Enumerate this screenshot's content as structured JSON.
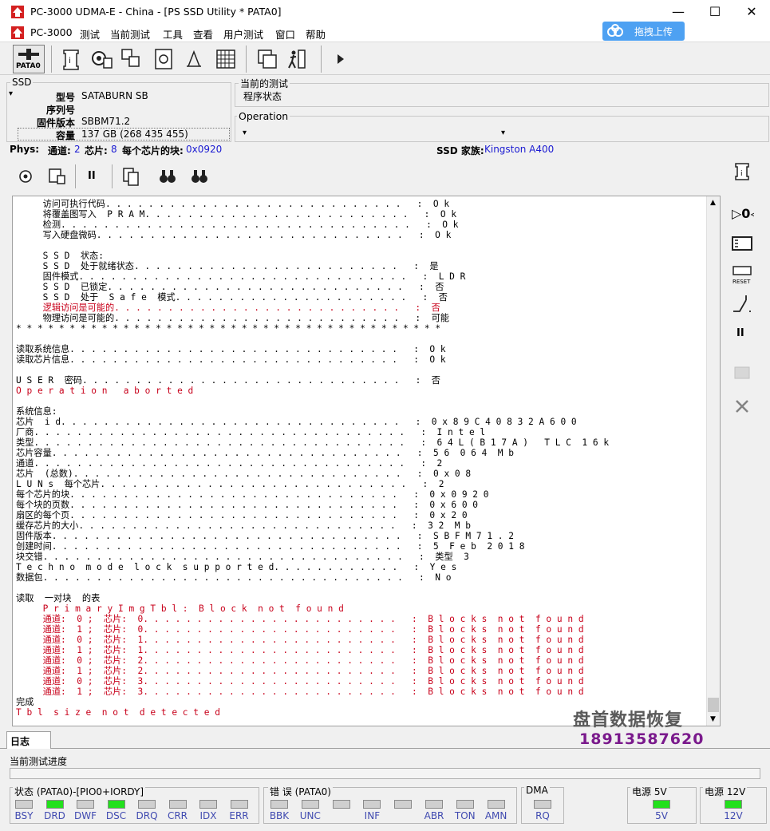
{
  "window": {
    "title": "PC-3000 UDMA-E - China - [PS SSD Utility * PATA0]",
    "minimize": "—",
    "maximize": "☐",
    "close": "✕"
  },
  "menu": {
    "items": [
      "PC-3000",
      "测试",
      "当前测试",
      "工具",
      "查看",
      "用户测试",
      "窗口",
      "帮助"
    ],
    "upload_label": "拖拽上传"
  },
  "toolbar": {
    "pata_label": "PATA0"
  },
  "ssd": {
    "group_label": "SSD",
    "model_label": "型号",
    "model_value": "SATABURN   SB",
    "serial_label": "序列号",
    "serial_value": "",
    "firmware_label": "固件版本",
    "firmware_value": "SBBM71.2",
    "capacity_label": "容量",
    "capacity_value": "137 GB (268 435 455)"
  },
  "current_test": {
    "group_label": "当前的测试",
    "value": "程序状态"
  },
  "operation": {
    "group_label": "Operation",
    "value": ""
  },
  "phys": {
    "label": "Phys:",
    "channel_label": "通道:",
    "channel_value": "2",
    "chips_label": "芯片:",
    "chips_value": "8",
    "blocks_label": "每个芯片的块:",
    "blocks_value": "0x0920",
    "family_label": "SSD 家族:",
    "family_value": "Kingston A400"
  },
  "log_lines": [
    {
      "t": "     访问可执行代码. . . . . . . . . . . . . . . . . . . . . . . . . . . .   :  O k",
      "red": false
    },
    {
      "t": "     将覆盖图写入  P R A M. . . . . . . . . . . . . . . . . . . . . . . . .   :  O k",
      "red": false
    },
    {
      "t": "     检测. . . . . . . . . . . . . . . . . . . . . . . . . . . . . . . . .   :  O k",
      "red": false
    },
    {
      "t": "     写入硬盘微码. . . . . . . . . . . . . . . . . . . . . . . . . . . . .   :  O k",
      "red": false
    },
    {
      "t": "",
      "red": false
    },
    {
      "t": "     S S D  状态:",
      "red": false
    },
    {
      "t": "     S S D  处于就绪状态. . . . . . . . . . . . . . . . . . . . . . . . .   :  是",
      "red": false
    },
    {
      "t": "     固件模式. . . . . . . . . . . . . . . . . . . . . . . . . . . . . . .   :  L D R",
      "red": false
    },
    {
      "t": "     S S D  已锁定. . . . . . . . . . . . . . . . . . . . . . . . . . . .   :  否",
      "red": false
    },
    {
      "t": "     S S D  处于  S a f e  模式. . . . . . . . . . . . . . . . . . . . . .   :  否",
      "red": false
    },
    {
      "t": "     逻辑访问是可能的. . . . . . . . . . . . . . . . . . . . . . . . . . .   :  否",
      "red": true
    },
    {
      "t": "     物理访问是可能的. . . . . . . . . . . . . . . . . . . . . . . . . . .   :  可能",
      "red": false
    },
    {
      "t": "* * * * * * * * * * * * * * * * * * * * * * * * * * * * * * * * * * * * * * * *",
      "red": false
    },
    {
      "t": "",
      "red": false
    },
    {
      "t": "读取系统信息. . . . . . . . . . . . . . . . . . . . . . . . . . . . . . .   :  O k",
      "red": false
    },
    {
      "t": "读取芯片信息. . . . . . . . . . . . . . . . . . . . . . . . . . . . . . .   :  O k",
      "red": false
    },
    {
      "t": "",
      "red": false
    },
    {
      "t": "U S E R  密码. . . . . . . . . . . . . . . . . . . . . . . . . . . . . .   :  否",
      "red": false
    },
    {
      "t": "O p e r a t i o n   a b o r t e d",
      "red": true
    },
    {
      "t": "",
      "red": false
    },
    {
      "t": "系统信息:",
      "red": false
    },
    {
      "t": "芯片  i d. . . . . . . . . . . . . . . . . . . . . . . . . . . . . . . .   :  0 x 8 9 C 4 0 8 3 2 A 6 0 0",
      "red": false
    },
    {
      "t": "厂商. . . . . . . . . . . . . . . . . . . . . . . . . . . . . . . . . . .   :  I n t e l",
      "red": false
    },
    {
      "t": "类型. . . . . . . . . . . . . . . . . . . . . . . . . . . . . . . . . . .   :  6 4 L ( B 1 7 A )   T L C  1 6 k",
      "red": false
    },
    {
      "t": "芯片容量. . . . . . . . . . . . . . . . . . . . . . . . . . . . . . . . .   :  5 6  0 6 4  M b",
      "red": false
    },
    {
      "t": "通道. . . . . . . . . . . . . . . . . . . . . . . . . . . . . . . . . . .   :  2",
      "red": false
    },
    {
      "t": "芯片  (总数). . . . . . . . . . . . . . . . . . . . . . . . . . . . . . .   :  0 x 0 8",
      "red": false
    },
    {
      "t": "L U N s  每个芯片. . . . . . . . . . . . . . . . . . . . . . . . . . . . .   :  2",
      "red": false
    },
    {
      "t": "每个芯片的块. . . . . . . . . . . . . . . . . . . . . . . . . . . . . . .   :  0 x 0 9 2 0",
      "red": false
    },
    {
      "t": "每个块的页数. . . . . . . . . . . . . . . . . . . . . . . . . . . . . . .   :  0 x 6 0 0",
      "red": false
    },
    {
      "t": "扇区的每个页. . . . . . . . . . . . . . . . . . . . . . . . . . . . . . .   :  0 x 2 0",
      "red": false
    },
    {
      "t": "缓存芯片的大小. . . . . . . . . . . . . . . . . . . . . . . . . . . . . .   :  3 2  M b",
      "red": false
    },
    {
      "t": "固件版本. . . . . . . . . . . . . . . . . . . . . . . . . . . . . . . . .   :  S B F M 7 1 . 2",
      "red": false
    },
    {
      "t": "创建时间. . . . . . . . . . . . . . . . . . . . . . . . . . . . . . . . .   :  5  F e b  2 0 1 8",
      "red": false
    },
    {
      "t": "块交错. . . . . . . . . . . . . . . . . . . . . . . . . . . . . . . . . .   :  类型  3",
      "red": false
    },
    {
      "t": "T e c h n o  m o d e  l o c k  s u p p o r t e d. . . . . . . . . . . .   :  Y e s",
      "red": false
    },
    {
      "t": "数据包. . . . . . . . . . . . . . . . . . . . . . . . . . . . . . . . . .   :  N o",
      "red": false
    },
    {
      "t": "",
      "red": false
    },
    {
      "t": "读取  一对块  的表",
      "red": false
    },
    {
      "t": "     P r i m a r y I m g T b l :  B l o c k  n o t  f o u n d",
      "red": true
    },
    {
      "t": "     通道:  0 ;  芯片:  0. . . . . . . . . . . . . . . . . . . . . . . .   :  B l o c k s  n o t  f o u n d",
      "red": true
    },
    {
      "t": "     通道:  1 ;  芯片:  0. . . . . . . . . . . . . . . . . . . . . . . .   :  B l o c k s  n o t  f o u n d",
      "red": true
    },
    {
      "t": "     通道:  0 ;  芯片:  1. . . . . . . . . . . . . . . . . . . . . . . .   :  B l o c k s  n o t  f o u n d",
      "red": true
    },
    {
      "t": "     通道:  1 ;  芯片:  1. . . . . . . . . . . . . . . . . . . . . . . .   :  B l o c k s  n o t  f o u n d",
      "red": true
    },
    {
      "t": "     通道:  0 ;  芯片:  2. . . . . . . . . . . . . . . . . . . . . . . .   :  B l o c k s  n o t  f o u n d",
      "red": true
    },
    {
      "t": "     通道:  1 ;  芯片:  2. . . . . . . . . . . . . . . . . . . . . . . .   :  B l o c k s  n o t  f o u n d",
      "red": true
    },
    {
      "t": "     通道:  0 ;  芯片:  3. . . . . . . . . . . . . . . . . . . . . . . .   :  B l o c k s  n o t  f o u n d",
      "red": true
    },
    {
      "t": "     通道:  1 ;  芯片:  3. . . . . . . . . . . . . . . . . . . . . . . .   :  B l o c k s  n o t  f o u n d",
      "red": true
    },
    {
      "t": "完成",
      "red": false
    },
    {
      "t": "T b l  s i z e  n o t  d e t e c t e d",
      "red": true
    }
  ],
  "tabs": {
    "log": "日志"
  },
  "progress": {
    "label": "当前测试进度",
    "fraction": 0
  },
  "status_group": {
    "label": "状态 (PATA0)-[PIO0+IORDY]",
    "leds": [
      {
        "name": "BSY",
        "on": false
      },
      {
        "name": "DRD",
        "on": true
      },
      {
        "name": "DWF",
        "on": false
      },
      {
        "name": "DSC",
        "on": true
      },
      {
        "name": "DRQ",
        "on": false
      },
      {
        "name": "CRR",
        "on": false
      },
      {
        "name": "IDX",
        "on": false
      },
      {
        "name": "ERR",
        "on": false
      }
    ]
  },
  "error_group": {
    "label": "错 误 (PATA0)",
    "leds": [
      {
        "name": "BBK",
        "on": false
      },
      {
        "name": "UNC",
        "on": false
      },
      {
        "name": "",
        "on": false
      },
      {
        "name": "INF",
        "on": false
      },
      {
        "name": "",
        "on": false
      },
      {
        "name": "ABR",
        "on": false
      },
      {
        "name": "TON",
        "on": false
      },
      {
        "name": "AMN",
        "on": false
      }
    ]
  },
  "dma_group": {
    "label": "DMA",
    "led": {
      "name": "RQ",
      "on": false
    }
  },
  "power5": {
    "label": "电源 5V",
    "led": {
      "name": "5V",
      "on": true
    }
  },
  "power12": {
    "label": "电源 12V",
    "led": {
      "name": "12V",
      "on": true
    }
  },
  "watermark": {
    "line1": "盘首数据恢复",
    "line2": "18913587620"
  },
  "colors": {
    "led_on": "#22e01c",
    "led_off": "#cfcfcf",
    "log_red": "#c8001a",
    "blue_value": "#1a1ad2",
    "upload_btn": "#4ea1f2"
  }
}
